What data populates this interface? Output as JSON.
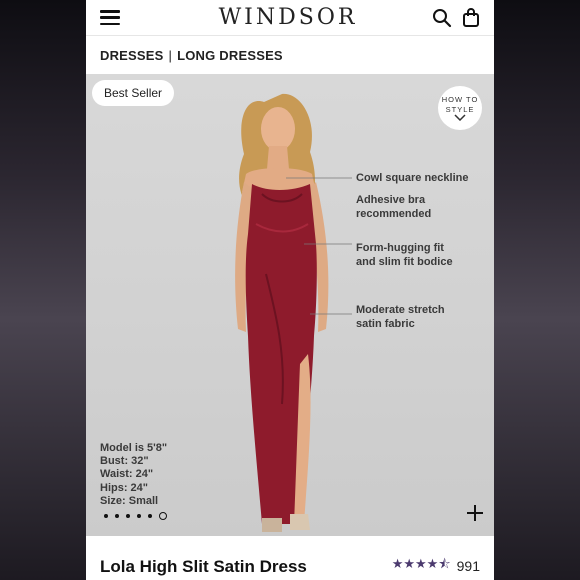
{
  "header": {
    "logo": "WINDSOR",
    "menu_icon": "hamburger-menu-icon",
    "search_icon": "search-icon",
    "bag_icon": "shopping-bag-icon"
  },
  "breadcrumb": {
    "items": [
      "DRESSES",
      "LONG DRESSES"
    ],
    "separator": "|"
  },
  "hero": {
    "badge": "Best Seller",
    "how_to_style": {
      "line1": "HOW TO",
      "line2": "STYLE"
    },
    "callouts": [
      {
        "line1": "Cowl square neckline",
        "line2": ""
      },
      {
        "line1": "Adhesive bra",
        "line2": "recommended"
      },
      {
        "line1": "Form-hugging fit",
        "line2": "and slim fit bodice"
      },
      {
        "line1": "Moderate stretch",
        "line2": "satin fabric"
      }
    ],
    "model_info": {
      "height": "Model is 5'8\"",
      "bust": "Bust: 32\"",
      "waist": "Waist: 24\"",
      "hips": "Hips: 24\"",
      "size": "Size: Small"
    },
    "carousel": {
      "total": 6,
      "active_index": 5
    },
    "dress_color": "#8e1b2c"
  },
  "product": {
    "name": "Lola High Slit Satin Dress",
    "rating": 4.5,
    "review_count": "991",
    "star_color": "#4b3a6e"
  }
}
